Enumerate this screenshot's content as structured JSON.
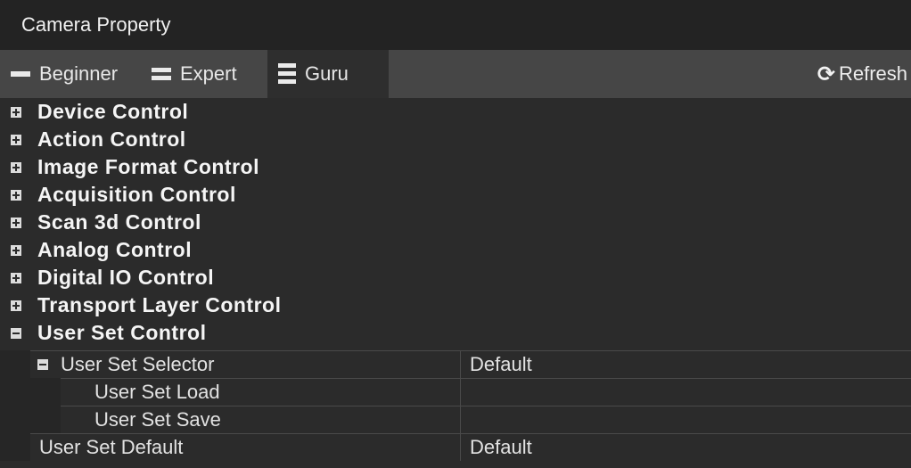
{
  "window": {
    "title": "Camera Property"
  },
  "toolbar": {
    "tabs": [
      {
        "label": "Beginner"
      },
      {
        "label": "Expert"
      },
      {
        "label": "Guru"
      }
    ],
    "refresh_label": "Refresh"
  },
  "tree": {
    "categories": [
      {
        "label": "Device Control",
        "expanded": false
      },
      {
        "label": "Action Control",
        "expanded": false
      },
      {
        "label": "Image Format Control",
        "expanded": false
      },
      {
        "label": "Acquisition Control",
        "expanded": false
      },
      {
        "label": "Scan 3d Control",
        "expanded": false
      },
      {
        "label": "Analog Control",
        "expanded": false
      },
      {
        "label": "Digital IO Control",
        "expanded": false
      },
      {
        "label": "Transport Layer Control",
        "expanded": false
      },
      {
        "label": "User Set Control",
        "expanded": true
      }
    ],
    "user_set": {
      "selector": {
        "name": "User Set Selector",
        "value": "Default"
      },
      "load": {
        "name": "User Set Load",
        "value": ""
      },
      "save": {
        "name": "User Set Save",
        "value": ""
      },
      "default": {
        "name": "User Set Default",
        "value": "Default"
      }
    }
  },
  "colors": {
    "background": "#2b2b2b",
    "titlebar": "#232323",
    "toolbar": "#464646",
    "active_tab": "#2e2e2e"
  }
}
